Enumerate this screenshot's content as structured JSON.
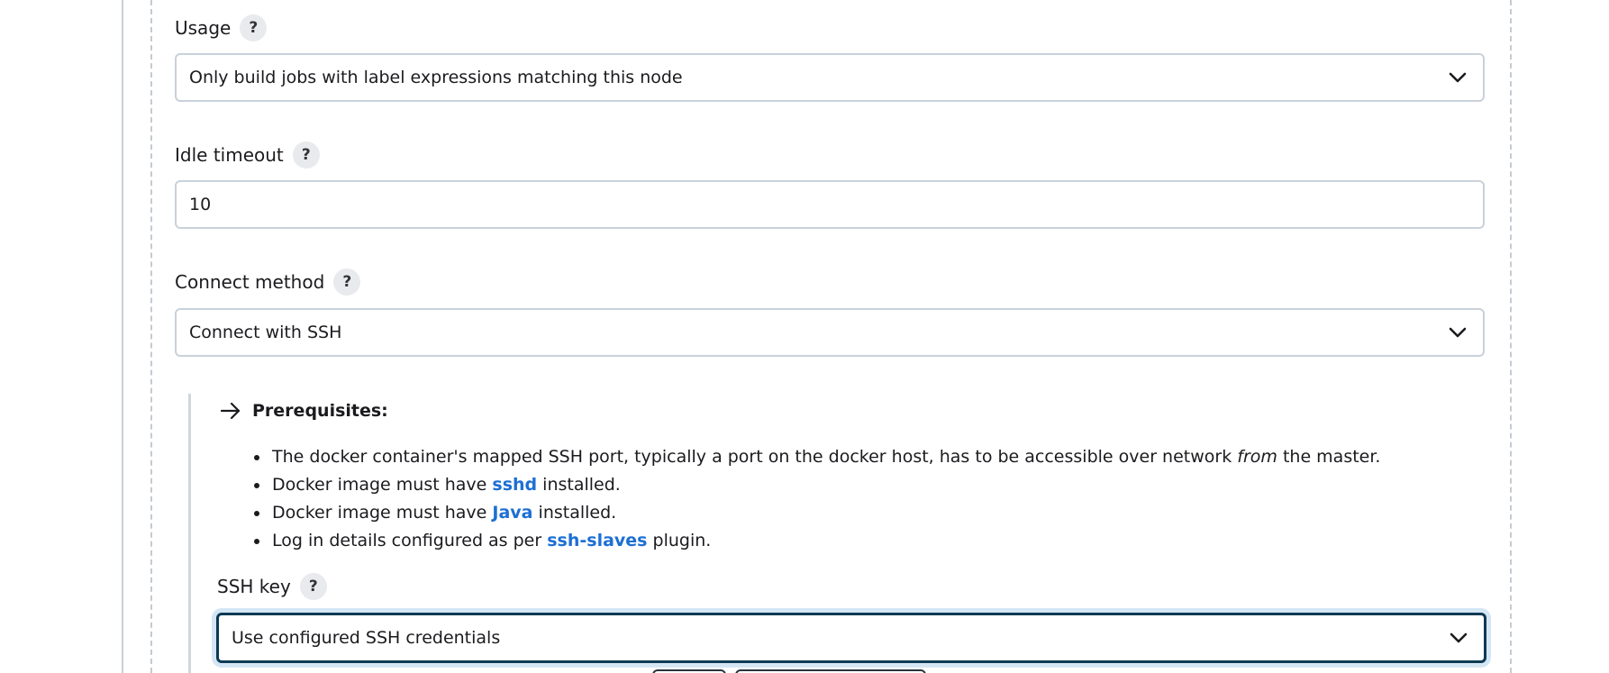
{
  "usage": {
    "label": "Usage",
    "help": "?",
    "selected": "Only build jobs with label expressions matching this node"
  },
  "idle_timeout": {
    "label": "Idle timeout",
    "help": "?",
    "value": "10"
  },
  "connect_method": {
    "label": "Connect method",
    "help": "?",
    "selected": "Connect with SSH"
  },
  "prerequisites": {
    "title": "Prerequisites:",
    "items": [
      {
        "before": "The docker container's mapped SSH port, typically a port on the docker host, has to be accessible over network ",
        "em": "from",
        "after": " the master."
      },
      {
        "before": "Docker image must have ",
        "link": "sshd",
        "after": " installed."
      },
      {
        "before": "Docker image must have ",
        "link": "Java",
        "after": " installed."
      },
      {
        "before": "Log in details configured as per ",
        "link": "ssh-slaves",
        "after": " plugin."
      }
    ]
  },
  "ssh_key": {
    "label": "SSH key",
    "help": "?",
    "selected": "Use configured SSH credentials"
  }
}
